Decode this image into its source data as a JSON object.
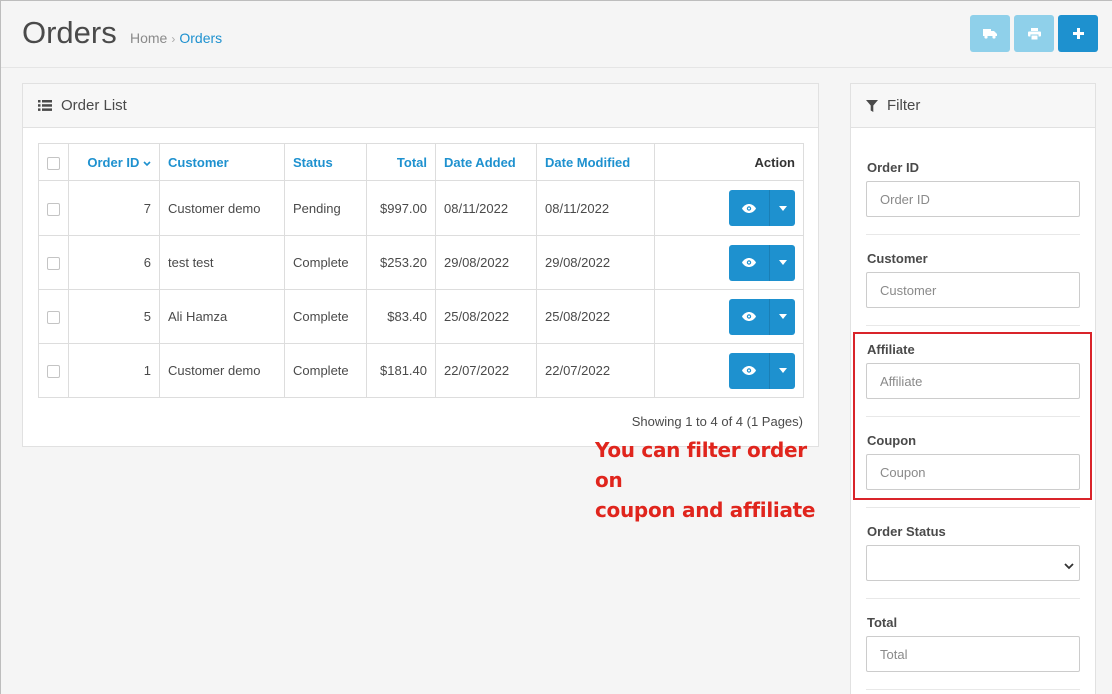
{
  "header": {
    "title": "Orders",
    "breadcrumb": [
      "Home",
      "Orders"
    ],
    "buttons": [
      {
        "icon": "truck-icon",
        "label": "Shipping"
      },
      {
        "icon": "print-icon",
        "label": "Print Invoice"
      },
      {
        "icon": "plus-icon",
        "label": "Add New"
      }
    ]
  },
  "order_list": {
    "title": "Order List",
    "columns": [
      "Order ID",
      "Customer",
      "Status",
      "Total",
      "Date Added",
      "Date Modified",
      "Action"
    ],
    "rows": [
      {
        "id": "7",
        "customer": "Customer demo",
        "status": "Pending",
        "total": "$997.00",
        "date_added": "08/11/2022",
        "date_modified": "08/11/2022"
      },
      {
        "id": "6",
        "customer": "test test",
        "status": "Complete",
        "total": "$253.20",
        "date_added": "29/08/2022",
        "date_modified": "29/08/2022"
      },
      {
        "id": "5",
        "customer": "Ali Hamza",
        "status": "Complete",
        "total": "$83.40",
        "date_added": "25/08/2022",
        "date_modified": "25/08/2022"
      },
      {
        "id": "1",
        "customer": "Customer demo",
        "status": "Complete",
        "total": "$181.40",
        "date_added": "22/07/2022",
        "date_modified": "22/07/2022"
      }
    ],
    "pagination_text": "Showing 1 to 4 of 4 (1 Pages)"
  },
  "annotation": {
    "line1": "You can filter order on",
    "line2": "coupon and affiliate",
    "color": "#e0251d"
  },
  "filter": {
    "title": "Filter",
    "fields": [
      {
        "label": "Order ID",
        "placeholder": "Order ID"
      },
      {
        "label": "Customer",
        "placeholder": "Customer"
      },
      {
        "label": "Affiliate",
        "placeholder": "Affiliate"
      },
      {
        "label": "Coupon",
        "placeholder": "Coupon"
      },
      {
        "label": "Order Status",
        "selected": ""
      },
      {
        "label": "Total",
        "placeholder": "Total"
      }
    ]
  },
  "colors": {
    "accent": "#1e91cf",
    "accent_light": "#8fd0ea",
    "highlight": "#d9242a"
  }
}
